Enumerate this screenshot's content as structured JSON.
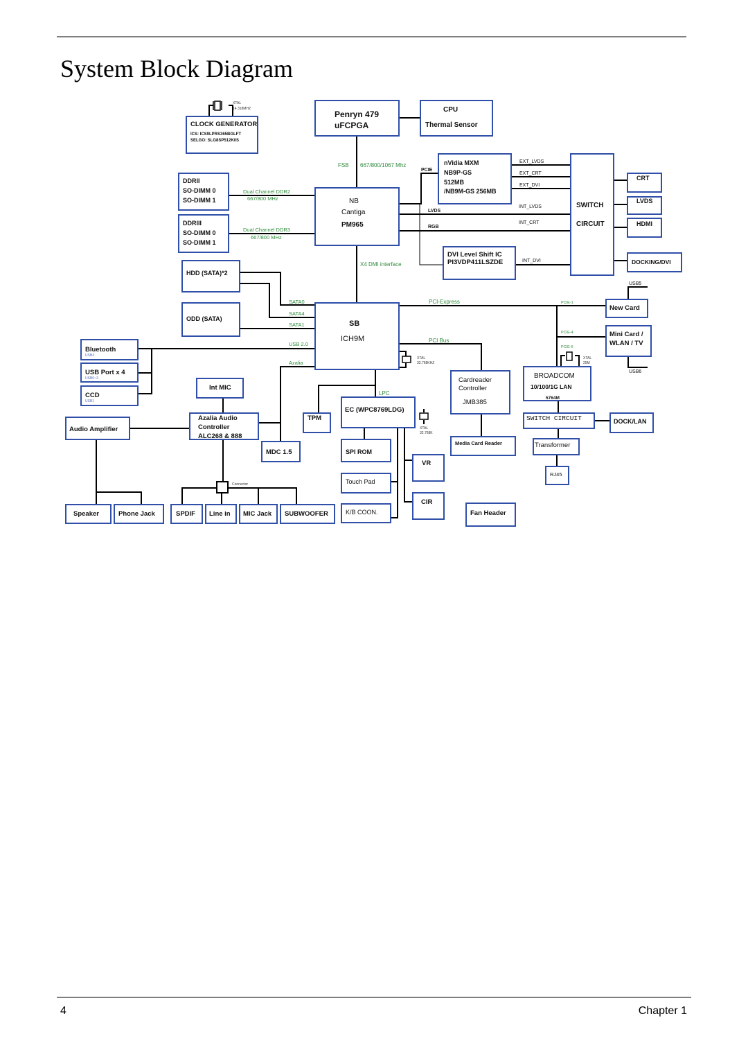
{
  "page": {
    "title": "System Block Diagram",
    "page_number": "4",
    "chapter": "Chapter 1"
  },
  "blocks": {
    "clock": {
      "l1": "CLOCK GENERATOR",
      "l2": "ICS: ICS9LPRS365BGLFT",
      "l3": "SELGO: SLG8SP512K0S",
      "xtal1": "XTAL",
      "xtal2": "14.318MHZ"
    },
    "cpu": {
      "l1": "Penryn 479",
      "l2": "uFCPGA"
    },
    "thermal": {
      "l1": "CPU",
      "l2": "Thermal Sensor"
    },
    "gpu": {
      "l1": "nVidia MXM",
      "l2": "NB9P-GS",
      "l3": "512MB",
      "l4": "/NB9M-GS 256MB"
    },
    "switch": {
      "l1": "SWITCH",
      "l2": "CIRCUIT"
    },
    "crt": "CRT",
    "lvds": "LVDS",
    "hdmi": "HDMI",
    "docking": "DOCKING/DVI",
    "ddr2": {
      "l1": "DDRII",
      "l2": "SO-DIMM 0",
      "l3": "SO-DIMM 1"
    },
    "ddr3": {
      "l1": "DDRIII",
      "l2": "SO-DIMM 0",
      "l3": "SO-DIMM 1"
    },
    "nb": {
      "l1": "NB",
      "l2": "Cantiga",
      "l3": "PM965"
    },
    "dvi_shift": {
      "l1": "DVI Level Shift IC",
      "l2": "PI3VDP411LSZDE"
    },
    "hdd": "HDD (SATA)*2",
    "odd": "ODD (SATA)",
    "sb": {
      "l1": "SB",
      "l2": "ICH9M"
    },
    "new_card": "New Card",
    "mini_card": {
      "l1": "Mini Card /",
      "l2": "WLAN / TV"
    },
    "bluetooth": {
      "l1": "Bluetooth",
      "l2": "USB4"
    },
    "usb_port": {
      "l1": "USB Port x 4",
      "l2": "USB0~3"
    },
    "ccd": {
      "l1": "CCD",
      "l2": "USB1"
    },
    "int_mic": "Int MIC",
    "audio_amp": "Audio Amplifier",
    "azalia": {
      "l1": "Azalia Audio",
      "l2": "Controller",
      "l3": "ALC268 & 888"
    },
    "mdc": "MDC 1.5",
    "tpm": "TPM",
    "ec": "EC (WPC8769LDG)",
    "spi_rom": "SPI ROM",
    "touch_pad": "Touch Pad",
    "kb": "K/B COON.",
    "vr": "VR",
    "cir": "CIR",
    "cardreader": {
      "l1": "Cardreader",
      "l2": "Controller",
      "l3": "JMB385"
    },
    "media_card": "Media Card Reader",
    "fan": "Fan Header",
    "broadcom": {
      "l1": "BROADCOM",
      "l2": "10/100/1G LAN",
      "l3": "5764M"
    },
    "lan_switch": "SWITCH CIRCUIT",
    "dock_lan": "DOCK/LAN",
    "transformer": "Transformer",
    "rj45": "RJ45",
    "speaker": "Speaker",
    "phone_jack": "Phone Jack",
    "spdif": "SPDIF",
    "line_in": "Line in",
    "mic_jack": "MIC Jack",
    "subwoofer": "SUBWOOFER"
  },
  "labels": {
    "fsb": "FSB",
    "fsb_speed": "667/800/1067 Mhz",
    "pcie": "PCIE",
    "ext_lvds": "EXT_LVDS",
    "ext_crt": "EXT_CRT",
    "ext_dvi": "EXT_DVI",
    "int_lvds": "INT_LVDS",
    "int_crt": "INT_CRT",
    "int_dvi": "INT_DVI",
    "lvds": "LVDS",
    "rgb": "RGB",
    "ddr2_l1": "Dual Channel DDR2",
    "ddr2_l2": "667/800 MHz",
    "ddr3_l1": "Dual Channel  DDR3",
    "ddr3_l2": "667/800 MHz",
    "dmi": "X4 DMI interface",
    "sata0": "SATA0",
    "sata4": "SATA4",
    "sata1": "SATA1",
    "usb20": "USB 2.0",
    "azalia": "Azalia",
    "pci_express": "PCI-Express",
    "pci_bus": "PCI Bus",
    "pcie1": "PCIE-1",
    "pcie4": "PCIE-4",
    "pcie6": "PCIE-6",
    "usb5": "USB5",
    "usb6": "USB6",
    "lpc": "LPC",
    "xtal": "XTAL",
    "xtal_sb": "32.768KHZ",
    "xtal_ec": "32.768K",
    "xtal_lan": "25M",
    "connector": "Connector"
  }
}
